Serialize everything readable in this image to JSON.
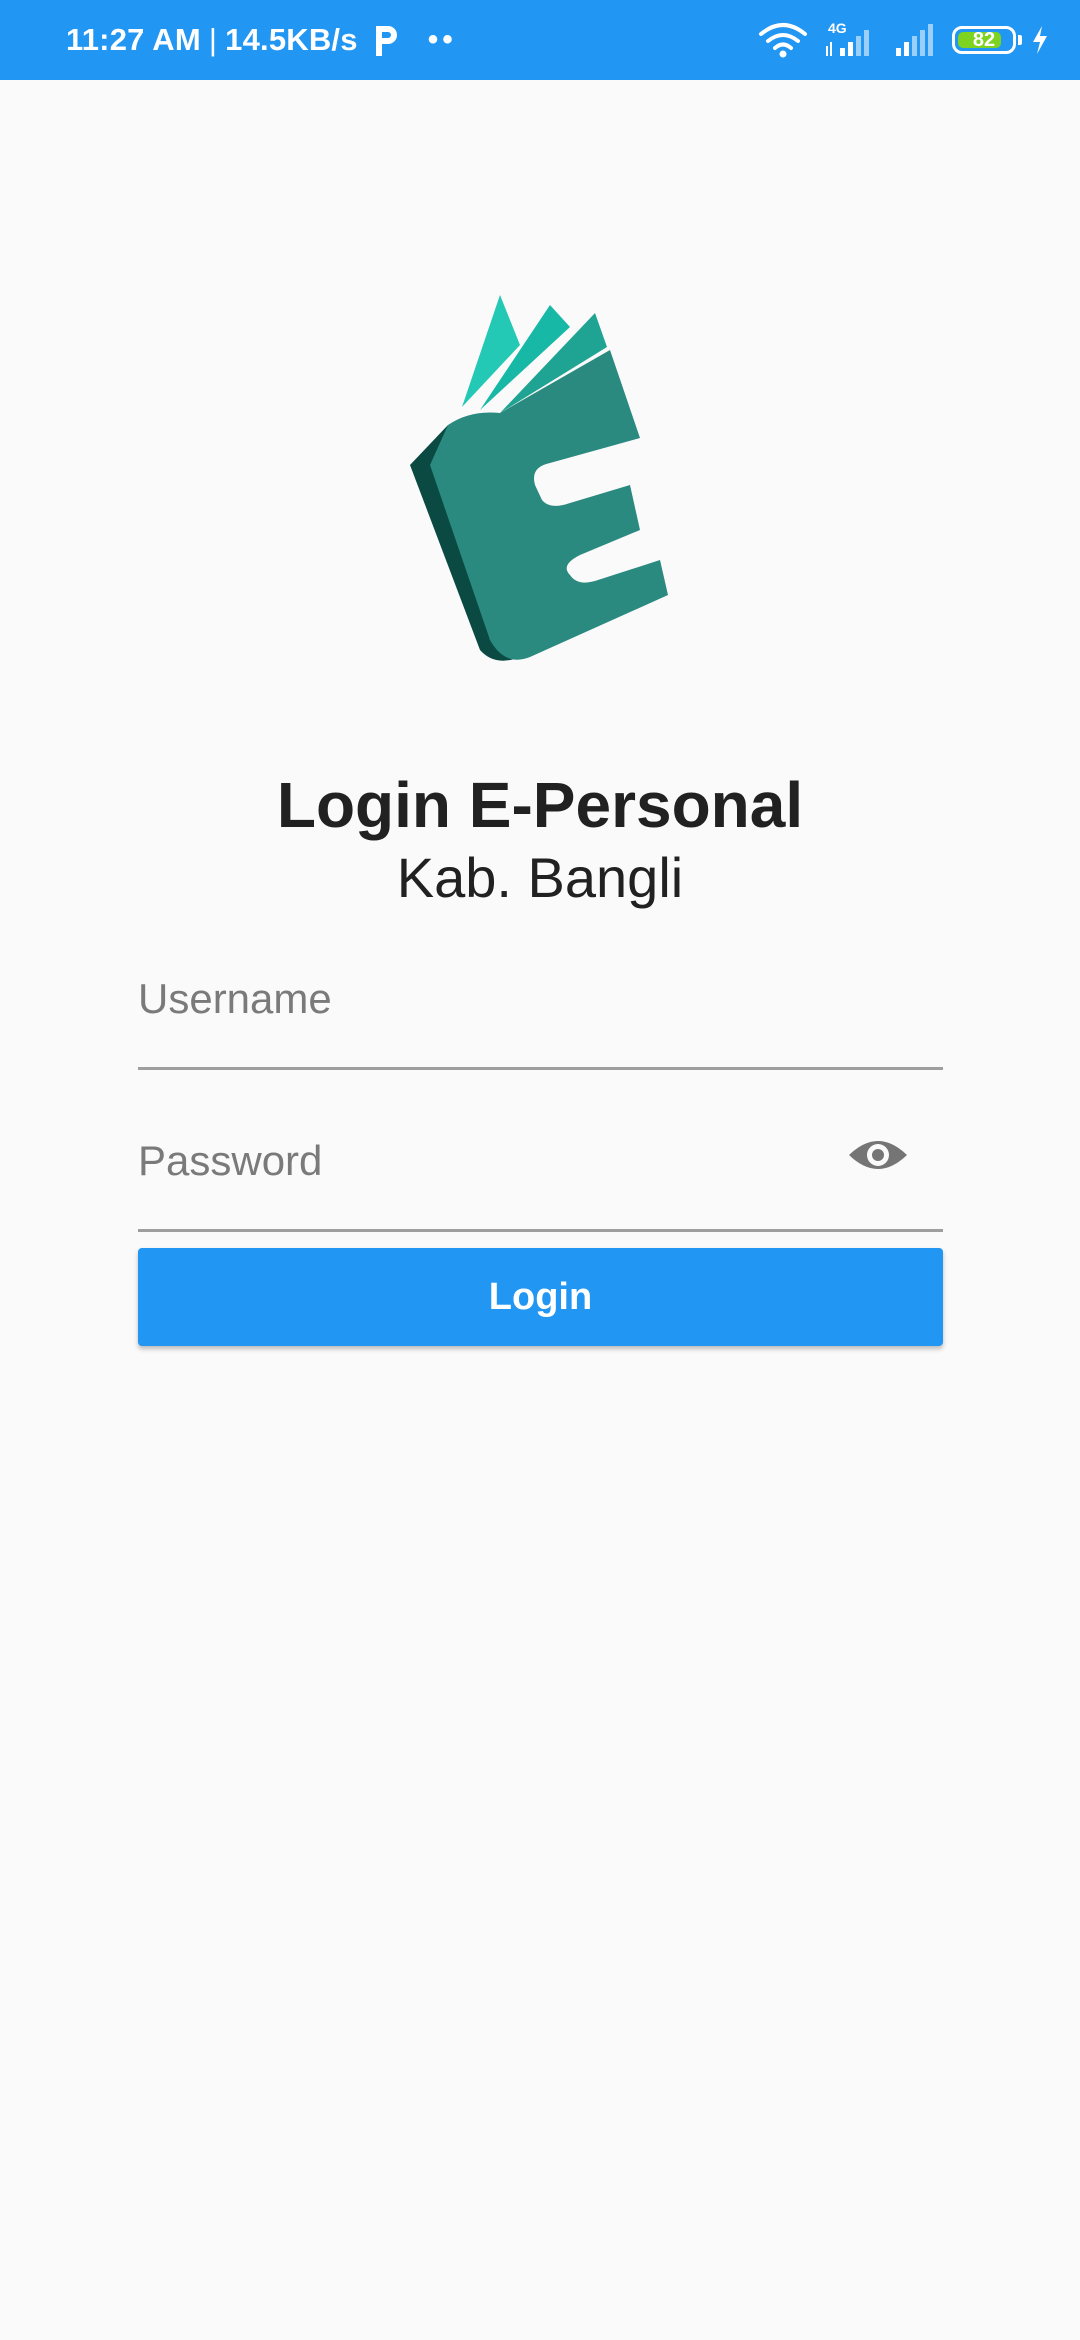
{
  "status_bar": {
    "time": "11:27 AM",
    "separator": "|",
    "network_speed": "14.5KB/s",
    "network_type": "4G",
    "battery_level": 82,
    "battery_text": "82",
    "icons": [
      "parking-icon",
      "more-dots-icon",
      "wifi-icon",
      "signal-4g-icon",
      "signal-icon",
      "battery-icon",
      "charging-icon"
    ],
    "colors": {
      "background": "#2196f3",
      "battery_fill": "#7ed321"
    }
  },
  "logo": {
    "icon": "book-e-logo-icon",
    "colors": [
      "#2a8a80",
      "#0a4a42",
      "#17c4b0"
    ]
  },
  "header": {
    "title": "Login E-Personal",
    "subtitle": "Kab. Bangli"
  },
  "form": {
    "username_placeholder": "Username",
    "username_value": "",
    "password_placeholder": "Password",
    "password_value": "",
    "password_toggle_icon": "eye-icon",
    "login_label": "Login"
  },
  "colors": {
    "accent": "#2196f3",
    "background": "#fafafa",
    "text": "#212121"
  }
}
